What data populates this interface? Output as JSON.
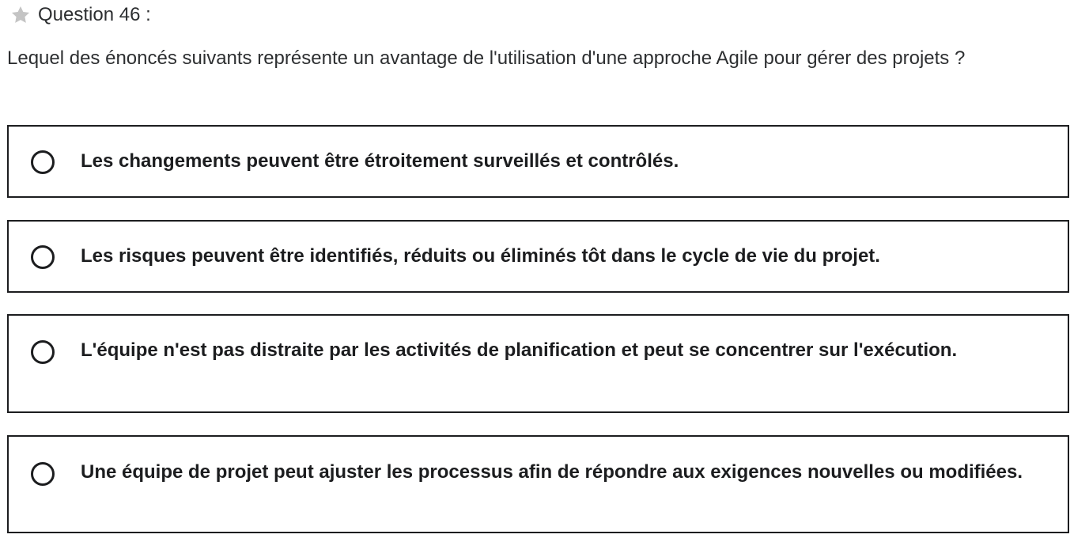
{
  "header": {
    "star_icon": "star-icon",
    "label": "Question 46 :"
  },
  "question": {
    "text": "Lequel des énoncés suivants représente un avantage de l'utilisation d'une approche Agile pour gérer des projets ?"
  },
  "options": [
    {
      "label": "Les changements peuvent être étroitement surveillés et contrôlés.",
      "selected": false
    },
    {
      "label": "Les risques peuvent être identifiés, réduits ou éliminés tôt dans le cycle de vie du projet.",
      "selected": false
    },
    {
      "label": "L'équipe n'est pas distraite par les activités de planification et peut se concentrer sur l'exécution.",
      "selected": false
    },
    {
      "label": "Une équipe de projet peut ajuster les processus afin de répondre aux exigences nouvelles ou modifiées.",
      "selected": false
    }
  ],
  "colors": {
    "text": "#1c1d1f",
    "border": "#1c1d1f",
    "star": "#c4c4c4"
  }
}
